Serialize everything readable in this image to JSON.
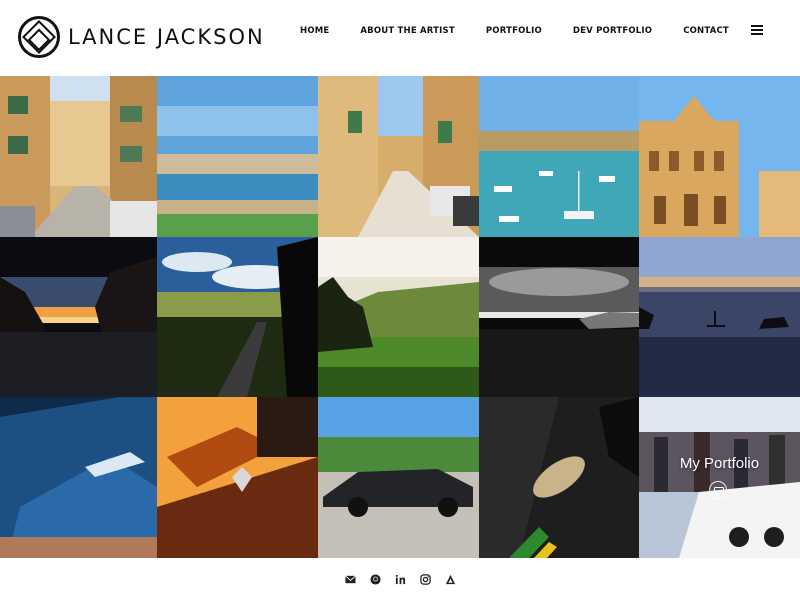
{
  "header": {
    "logo_text": "LANCE JACKSON",
    "nav": [
      "HOME",
      "ABOUT THE ARTIST",
      "PORTFOLIO",
      "DEV PORTFOLIO",
      "CONTACT"
    ],
    "menu_icon": "hamburger-menu-icon"
  },
  "gallery": {
    "tiles": [
      {
        "subject": "street-balconies"
      },
      {
        "subject": "harbour-panorama"
      },
      {
        "subject": "narrow-street"
      },
      {
        "subject": "harbour-boats"
      },
      {
        "subject": "palace-facade"
      },
      {
        "subject": "sunset-rocks"
      },
      {
        "subject": "country-road-sky"
      },
      {
        "subject": "green-hill-sunrise"
      },
      {
        "subject": "black-white-coast"
      },
      {
        "subject": "paddleboard-lake"
      },
      {
        "subject": "blue-supercar"
      },
      {
        "subject": "orange-supercar"
      },
      {
        "subject": "black-supercar-road"
      },
      {
        "subject": "carbon-car-detail"
      },
      {
        "subject": "white-supercar-crowd"
      }
    ],
    "overlay": {
      "title": "My Portfolio",
      "icon": "camera-icon"
    }
  },
  "footer": {
    "social_icons": [
      "envelope-icon",
      "github-icon",
      "linkedin-icon",
      "instagram-icon",
      "behance-icon"
    ]
  },
  "colors": {
    "text": "#111111",
    "background": "#ffffff"
  }
}
